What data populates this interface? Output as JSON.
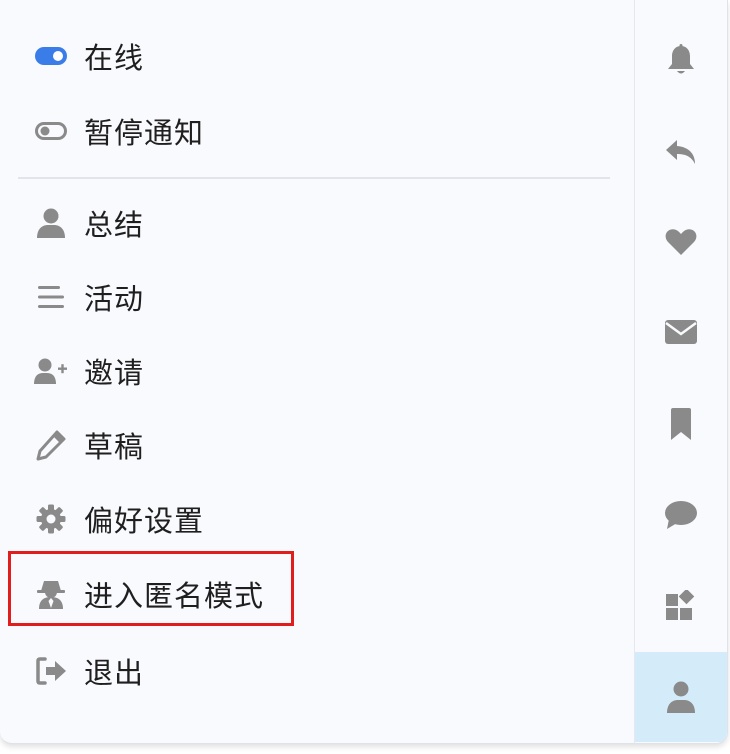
{
  "menu": {
    "status_online": "在线",
    "pause_notifications": "暂停通知",
    "items": [
      {
        "label": "总结",
        "icon": "user-icon"
      },
      {
        "label": "活动",
        "icon": "bars-icon"
      },
      {
        "label": "邀请",
        "icon": "user-plus-icon"
      },
      {
        "label": "草稿",
        "icon": "pencil-icon"
      },
      {
        "label": "偏好设置",
        "icon": "gear-icon"
      },
      {
        "label": "进入匿名模式",
        "icon": "incognito-icon"
      },
      {
        "label": "退出",
        "icon": "sign-out-icon"
      }
    ]
  },
  "rail": {
    "icons": [
      "bell-icon",
      "reply-icon",
      "heart-icon",
      "envelope-icon",
      "bookmark-icon",
      "comment-icon",
      "shapes-icon",
      "user-icon"
    ],
    "active_index": 7
  },
  "colors": {
    "accent_blue": "#3b7de8",
    "icon_gray": "#8a8a8a",
    "active_bg": "#d4ecfa",
    "highlight_red": "#e01e1e"
  }
}
